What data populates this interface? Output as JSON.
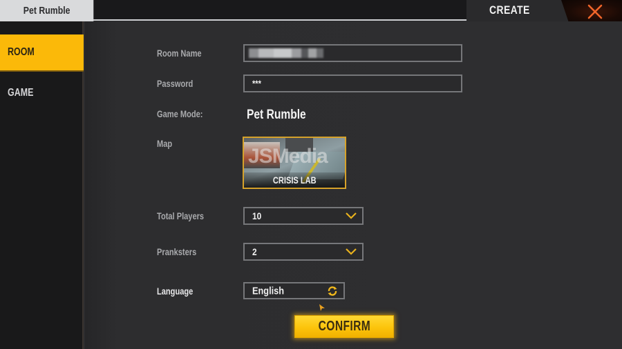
{
  "header": {
    "mode_tab": "Pet Rumble",
    "title": "CREATE",
    "close_icon": "close-x-icon",
    "accent_color": "#fbb909",
    "close_color": "#f0652a"
  },
  "sidebar": {
    "items": [
      {
        "label": "ROOM",
        "active": true
      },
      {
        "label": "GAME",
        "active": false
      }
    ]
  },
  "form": {
    "room_name": {
      "label": "Room Name",
      "value": "[pixelated]"
    },
    "password": {
      "label": "Password",
      "value": "***"
    },
    "game_mode": {
      "label": "Game Mode:",
      "value": "Pet Rumble"
    },
    "map": {
      "label": "Map",
      "name": "CRISIS LAB",
      "watermark": "JSMedia"
    },
    "total_players": {
      "label": "Total Players",
      "value": "10",
      "icon": "chevron-down-icon"
    },
    "pranksters": {
      "label": "Pranksters",
      "value": "2",
      "icon": "chevron-down-icon"
    },
    "language": {
      "label": "Language",
      "value": "English",
      "icon": "sync-icon"
    }
  },
  "actions": {
    "confirm_label": "CONFIRM"
  }
}
